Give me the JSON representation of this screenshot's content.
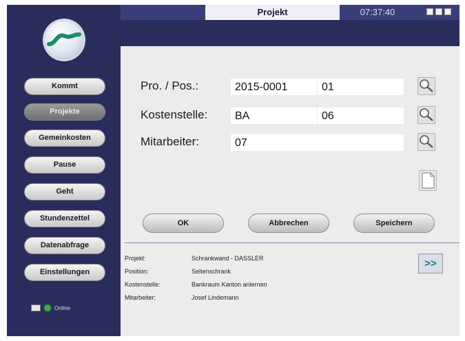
{
  "header": {
    "title": "Projekt",
    "clock": "07:37:40"
  },
  "sidebar": {
    "items": [
      {
        "label": "Kommt"
      },
      {
        "label": "Projekte"
      },
      {
        "label": "Gemeinkosten"
      },
      {
        "label": "Pause"
      },
      {
        "label": "Geht"
      },
      {
        "label": "Stundenzettel"
      },
      {
        "label": "Datenabfrage"
      },
      {
        "label": "Einstellungen"
      }
    ],
    "status": "Online"
  },
  "form": {
    "project_pos_label": "Pro. / Pos.:",
    "project_value": "2015-0001",
    "pos_value": "01",
    "kostenstelle_label": "Kostenstelle:",
    "kostenstelle_value": "BA",
    "kostenstelle_sub": "06",
    "mitarbeiter_label": "Mitarbeiter:",
    "mitarbeiter_value": "07"
  },
  "actions": {
    "ok": "OK",
    "cancel": "Abbrechen",
    "save": "Speichern"
  },
  "info": {
    "projekt_label": "Projekt:",
    "projekt_value": "Schrankwand - DASSLER",
    "position_label": "Position:",
    "position_value": "Seitenschrank",
    "kostenstelle_label": "Kostenstelle:",
    "kostenstelle_value": "Bankraum Kanton anlernen",
    "mitarbeiter_label": "Mitarbeiter:",
    "mitarbeiter_value": "Josef Lindemann"
  },
  "forward_label": ">>",
  "colors": {
    "background": "#2a2d5c",
    "panel": "#ececec",
    "accent": "#0a7d8c",
    "online": "#23c61e"
  },
  "icons": {
    "search": "magnifier-icon",
    "note": "document-icon"
  }
}
